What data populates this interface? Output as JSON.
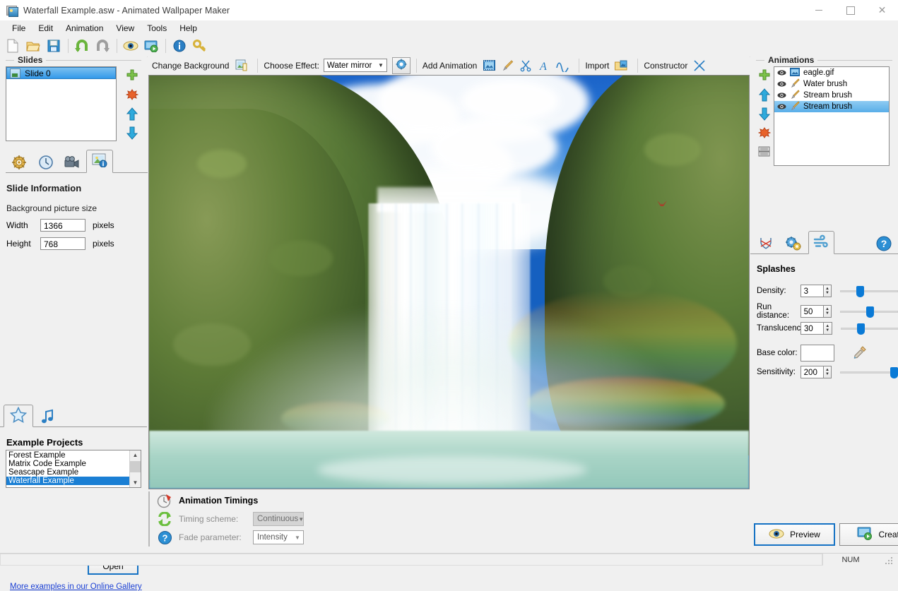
{
  "window": {
    "title": "Waterfall Example.asw - Animated Wallpaper Maker",
    "icon": "app-icon",
    "minimize": "–",
    "maximize": "□",
    "close": "✕"
  },
  "menu": {
    "items": [
      "File",
      "Edit",
      "Animation",
      "View",
      "Tools",
      "Help"
    ]
  },
  "toolbar": {
    "buttons": [
      {
        "name": "new-icon",
        "tip": "New"
      },
      {
        "name": "open-folder-icon",
        "tip": "Open"
      },
      {
        "name": "save-floppy-icon",
        "tip": "Save"
      },
      {
        "name": "undo-icon",
        "tip": "Undo"
      },
      {
        "name": "redo-icon",
        "tip": "Redo"
      },
      {
        "name": "preview-eye-icon",
        "tip": "Preview"
      },
      {
        "name": "create-monitor-icon",
        "tip": "Create"
      },
      {
        "name": "info-icon",
        "tip": "About"
      },
      {
        "name": "key-icon",
        "tip": "Register"
      }
    ]
  },
  "slides": {
    "group_title": "Slides",
    "items": [
      {
        "label": "Slide 0",
        "selected": true
      }
    ],
    "buttons": [
      {
        "name": "add-slide-button",
        "glyph": "+"
      },
      {
        "name": "delete-slide-button",
        "glyph": "✖"
      },
      {
        "name": "move-slide-up-button",
        "glyph": "▲"
      },
      {
        "name": "move-slide-down-button",
        "glyph": "▼"
      }
    ],
    "tabs": [
      {
        "name": "tab-slide-settings",
        "icon": "gear-wheel-icon",
        "active": false
      },
      {
        "name": "tab-slide-timing",
        "icon": "clock-icon",
        "active": false
      },
      {
        "name": "tab-slide-video",
        "icon": "video-camera-icon",
        "active": false
      },
      {
        "name": "tab-slide-information",
        "icon": "picture-info-icon",
        "active": true
      }
    ]
  },
  "slide_information": {
    "heading": "Slide Information",
    "subheading": "Background picture size",
    "width_label": "Width",
    "width_value": "1366",
    "height_label": "Height",
    "height_value": "768",
    "units": "pixels"
  },
  "examples": {
    "tabs": [
      {
        "name": "tab-example-projects",
        "icon": "star-icon",
        "active": true
      },
      {
        "name": "tab-music",
        "icon": "music-note-icon",
        "active": false
      }
    ],
    "heading": "Example Projects",
    "items": [
      {
        "label": "Forest Example",
        "selected": false
      },
      {
        "label": "Matrix Code Example",
        "selected": false
      },
      {
        "label": "Seascape Example",
        "selected": false
      },
      {
        "label": "Waterfall Example",
        "selected": true
      }
    ],
    "open_button": "Open",
    "gallery_link": "More examples in our Online Gallery"
  },
  "effect_bar": {
    "change_background": "Change Background",
    "change_background_icon": "picture-icon",
    "choose_effect_label": "Choose Effect:",
    "effect_value": "Water mirror",
    "effect_settings_icon": "effect-gear-icon",
    "add_animation": "Add Animation",
    "animation_tools": [
      {
        "name": "add-sprite-icon",
        "glyph": "sprite"
      },
      {
        "name": "add-brush-icon",
        "glyph": "brush"
      },
      {
        "name": "add-scissors-icon",
        "glyph": "scissors"
      },
      {
        "name": "add-text-icon",
        "glyph": "text-A"
      },
      {
        "name": "add-wave-icon",
        "glyph": "wave"
      }
    ],
    "import": "Import",
    "import_icon": "import-icon",
    "constructor": "Constructor",
    "constructor_icon": "constructor-tools-icon"
  },
  "canvas": {
    "name": "waterfall-preview-canvas",
    "description": "Waterfall scene with mossy green cliffs, blue sky with white clouds, rainbow and turquoise pool",
    "sprite": "eagle"
  },
  "animation_timings": {
    "title": "Animation Timings",
    "title_icon": "timings-clock-icon",
    "timing_scheme_label": "Timing scheme:",
    "timing_scheme_value": "Continuous",
    "timing_scheme_icon": "loop-arrows-icon",
    "fade_parameter_label": "Fade parameter:",
    "fade_parameter_value": "Intensity",
    "fade_parameter_icon": "question-icon"
  },
  "animations": {
    "group_title": "Animations",
    "items": [
      {
        "label": "eagle.gif",
        "icon": "sprite-icon",
        "selected": false
      },
      {
        "label": "Water brush",
        "icon": "brush-icon",
        "selected": false
      },
      {
        "label": "Stream brush",
        "icon": "brush-icon",
        "selected": false
      },
      {
        "label": "Stream brush",
        "icon": "brush-icon",
        "selected": true
      }
    ],
    "buttons": [
      {
        "name": "add-animation-button",
        "glyph": "+"
      },
      {
        "name": "move-animation-up-button",
        "glyph": "▲"
      },
      {
        "name": "move-animation-down-button",
        "glyph": "▼"
      },
      {
        "name": "delete-animation-button",
        "glyph": "✖"
      },
      {
        "name": "duplicate-animation-button",
        "glyph": "copy"
      }
    ],
    "tabs": [
      {
        "name": "tab-animation-shape",
        "icon": "shape-icon",
        "active": false
      },
      {
        "name": "tab-animation-settings",
        "icon": "gears-icon",
        "active": false
      },
      {
        "name": "tab-animation-splashes",
        "icon": "wind-icon",
        "active": true
      }
    ],
    "help_icon": "help-question-icon"
  },
  "splashes": {
    "heading": "Splashes",
    "rows": [
      {
        "label": "Density:",
        "value": "3",
        "slider_percent": 30
      },
      {
        "label": "Run distance:",
        "value": "50",
        "slider_percent": 50
      },
      {
        "label": "Translucency:",
        "value": "30",
        "slider_percent": 30
      }
    ],
    "base_color_label": "Base color:",
    "base_color_value": "#ffffff",
    "dropper_icon": "eyedropper-icon",
    "sensitivity_label": "Sensitivity:",
    "sensitivity_value": "200",
    "sensitivity_percent": 97
  },
  "actions": {
    "preview": "Preview",
    "preview_icon": "eye-icon",
    "create": "Create",
    "create_icon": "monitor-icon"
  },
  "statusbar": {
    "message": "",
    "num_lock": "NUM"
  },
  "colors": {
    "accent_blue": "#0a7ad6",
    "selection_blue": "#3399ea",
    "panel_bg": "#f0f0f0",
    "link": "#1a3fd4"
  }
}
